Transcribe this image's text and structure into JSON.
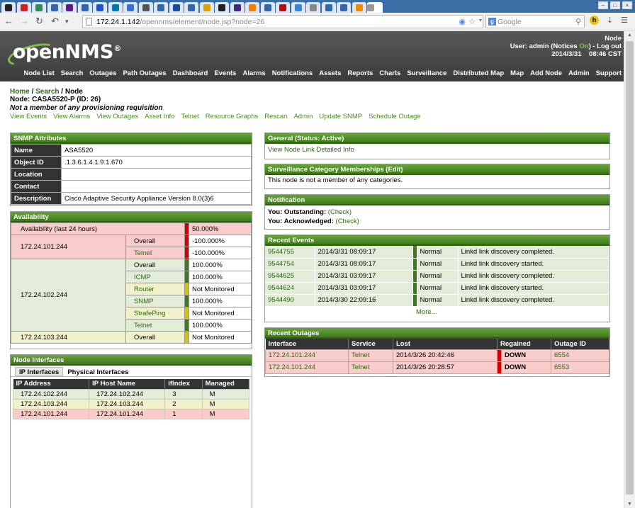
{
  "browser": {
    "tab_icons": [
      {
        "name": "dog-icon",
        "color": "#222"
      },
      {
        "name": "red-square-icon",
        "color": "#cc2222"
      },
      {
        "name": "green-doc-icon",
        "color": "#2e8b57"
      },
      {
        "name": "picture-icon",
        "color": "#3366aa"
      },
      {
        "name": "yahoo-icon",
        "color": "#5c1a8a"
      },
      {
        "name": "picture-icon",
        "color": "#3366aa"
      },
      {
        "name": "blue-square-icon",
        "color": "#2255cc"
      },
      {
        "name": "linkedin-icon",
        "color": "#0077b5"
      },
      {
        "name": "blue-square-icon",
        "color": "#3a6ed0"
      },
      {
        "name": "paw-icon",
        "color": "#555"
      },
      {
        "name": "picture-icon",
        "color": "#3366aa"
      },
      {
        "name": "e-icon",
        "color": "#1a4a9a"
      },
      {
        "name": "picture-icon",
        "color": "#3366aa"
      },
      {
        "name": "smiley-icon",
        "color": "#e0a000"
      },
      {
        "name": "linux-icon",
        "color": "#222"
      },
      {
        "name": "ux-icon",
        "color": "#3b2b7a"
      },
      {
        "name": "blogger-icon",
        "color": "#f57d00"
      },
      {
        "name": "picture-icon",
        "color": "#3366aa"
      },
      {
        "name": "s-icon",
        "color": "#b01010"
      },
      {
        "name": "cd-icon",
        "color": "#3a86d0"
      },
      {
        "name": "page-icon",
        "color": "#888"
      },
      {
        "name": "picture-icon",
        "color": "#3366aa"
      },
      {
        "name": "picture-icon",
        "color": "#3366aa"
      },
      {
        "name": "orange-icon",
        "color": "#f08a00"
      }
    ],
    "url_host": "172.24.1.142",
    "url_path": "/opennms/element/node.jsp?node=26",
    "search_placeholder": "Google"
  },
  "header": {
    "logo_text_a": "open",
    "logo_text_b": "NMS",
    "logo_reg": "®",
    "node_label": "Node",
    "user_prefix": "User: admin (Notices ",
    "notices_state": "On",
    "user_suffix": ") - Log out",
    "datetime": "2014/3/31    08:46 CST",
    "nav": [
      "Node List",
      "Search",
      "Outages",
      "Path Outages",
      "Dashboard",
      "Events",
      "Alarms",
      "Notifications",
      "Assets",
      "Reports",
      "Charts",
      "Surveillance",
      "Distributed Map",
      "Map",
      "Add Node",
      "Admin",
      "Support"
    ]
  },
  "breadcrumb": {
    "home": "Home",
    "search": "Search",
    "current": "Node"
  },
  "node": {
    "title": "Node: CASA5520-P (ID: 26)",
    "provisioning": "Not a member of any provisioning requisition",
    "links": [
      "View Events",
      "View Alarms",
      "View Outages",
      "Asset Info",
      "Telnet",
      "Resource Graphs",
      "Rescan",
      "Admin",
      "Update SNMP",
      "Schedule Outage"
    ]
  },
  "snmp": {
    "title": "SNMP Attributes",
    "rows": [
      {
        "k": "Name",
        "v": "ASA5520"
      },
      {
        "k": "Object ID",
        "v": ".1.3.6.1.4.1.9.1.670"
      },
      {
        "k": "Location",
        "v": ""
      },
      {
        "k": "Contact",
        "v": ""
      },
      {
        "k": "Description",
        "v": "Cisco Adaptive Security Appliance Version 8.0(3)6"
      }
    ]
  },
  "availability": {
    "title": "Availability",
    "summary_label": "Availability (last 24 hours)",
    "summary_value": "50.000%",
    "interfaces": [
      {
        "ip": "172.24.101.244",
        "services": [
          {
            "name": "Overall",
            "value": "-100.000%",
            "state": "red"
          },
          {
            "name": "Telnet",
            "value": "-100.000%",
            "state": "red"
          }
        ]
      },
      {
        "ip": "172.24.102.244",
        "services": [
          {
            "name": "Overall",
            "value": "100.000%",
            "state": "grn"
          },
          {
            "name": "ICMP",
            "value": "100.000%",
            "state": "grn"
          },
          {
            "name": "Router",
            "value": "Not Monitored",
            "state": "yel"
          },
          {
            "name": "SNMP",
            "value": "100.000%",
            "state": "grn"
          },
          {
            "name": "StrafePing",
            "value": "Not Monitored",
            "state": "yel"
          },
          {
            "name": "Telnet",
            "value": "100.000%",
            "state": "grn"
          }
        ]
      },
      {
        "ip": "172.24.103.244",
        "services": [
          {
            "name": "Overall",
            "value": "Not Monitored",
            "state": "yel"
          }
        ]
      }
    ]
  },
  "node_interfaces": {
    "title": "Node Interfaces",
    "tabs": [
      "IP Interfaces",
      "Physical Interfaces"
    ],
    "columns": [
      "IP Address",
      "IP Host Name",
      "ifIndex",
      "Managed"
    ],
    "rows": [
      {
        "ip": "172.24.102.244",
        "host": "172.24.102.244",
        "ifindex": "3",
        "managed": "M",
        "state": "g1"
      },
      {
        "ip": "172.24.103.244",
        "host": "172.24.103.244",
        "ifindex": "2",
        "managed": "M",
        "state": "y1"
      },
      {
        "ip": "172.24.101.244",
        "host": "172.24.101.244",
        "ifindex": "1",
        "managed": "M",
        "state": "r1"
      }
    ]
  },
  "general": {
    "title": "General (Status: Active)",
    "link": "View Node Link Detailed Info"
  },
  "surveillance": {
    "title": "Surveillance Category Memberships (Edit)",
    "text": "This node is not a member of any categories."
  },
  "notification": {
    "title": "Notification",
    "outstanding_label": "You: Outstanding:",
    "outstanding_link": "(Check)",
    "ack_label": "You: Acknowledged:",
    "ack_link": "(Check)"
  },
  "recent_events": {
    "title": "Recent Events",
    "rows": [
      {
        "id": "9544755",
        "time": "2014/3/31 08:09:17",
        "severity": "Normal",
        "msg": "Linkd link discovery completed."
      },
      {
        "id": "9544754",
        "time": "2014/3/31 08:09:17",
        "severity": "Normal",
        "msg": "Linkd link discovery started."
      },
      {
        "id": "9544625",
        "time": "2014/3/31 03:09:17",
        "severity": "Normal",
        "msg": "Linkd link discovery completed."
      },
      {
        "id": "9544624",
        "time": "2014/3/31 03:09:17",
        "severity": "Normal",
        "msg": "Linkd link discovery started."
      },
      {
        "id": "9544490",
        "time": "2014/3/30 22:09:16",
        "severity": "Normal",
        "msg": "Linkd link discovery completed."
      }
    ],
    "more": "More..."
  },
  "recent_outages": {
    "title": "Recent Outages",
    "columns": [
      "Interface",
      "Service",
      "Lost",
      "Regained",
      "Outage ID"
    ],
    "rows": [
      {
        "iface": "172.24.101.244",
        "service": "Telnet",
        "lost": "2014/3/26 20:42:46",
        "regained": "DOWN",
        "id": "6554"
      },
      {
        "iface": "172.24.101.244",
        "service": "Telnet",
        "lost": "2014/3/26 20:28:57",
        "regained": "DOWN",
        "id": "6553"
      }
    ]
  }
}
